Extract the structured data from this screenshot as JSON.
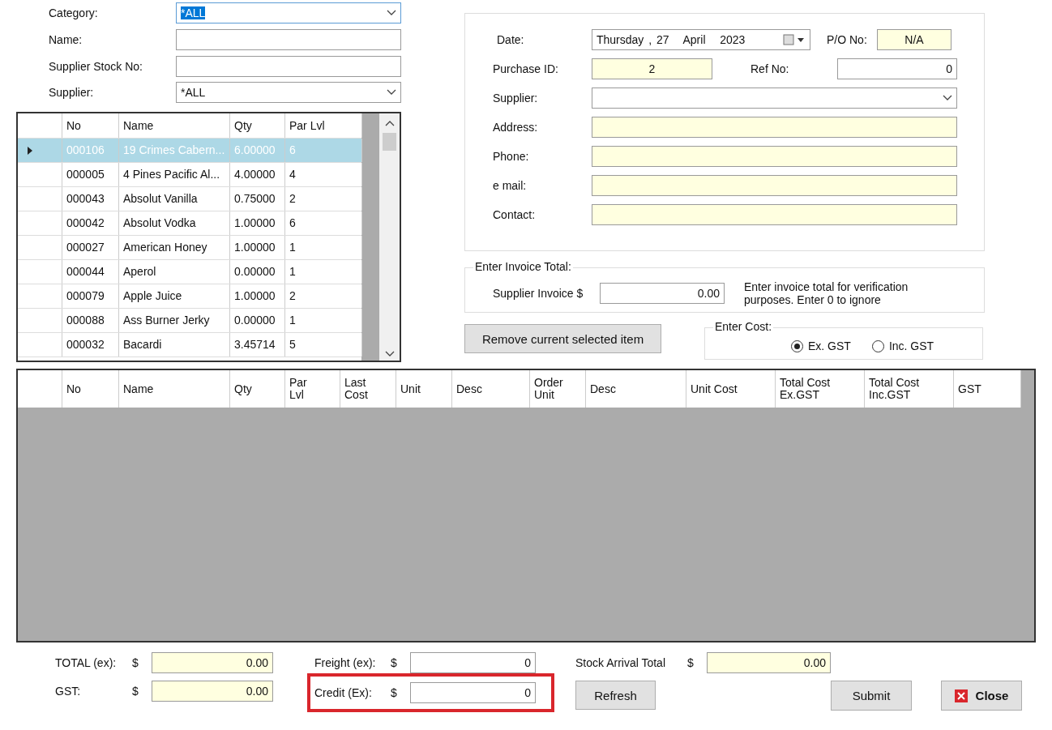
{
  "filters": [
    {
      "kind": "dropdown",
      "label": "Category:",
      "value": "*ALL",
      "highlighted": true
    },
    {
      "kind": "text",
      "label": "Name:"
    },
    {
      "kind": "text",
      "label": "Supplier Stock No:"
    },
    {
      "kind": "dropdown",
      "label": "Supplier:",
      "value": "*ALL",
      "highlighted": false
    }
  ],
  "item_grid": {
    "columns": [
      "No",
      "Name",
      "Qty",
      "Par Lvl"
    ],
    "rows": [
      {
        "selected": true,
        "cells": [
          "000106",
          "19 Crimes Cabern...",
          "6.00000",
          "6"
        ]
      },
      {
        "selected": false,
        "cells": [
          "000005",
          "4 Pines Pacific Al...",
          "4.00000",
          "4"
        ]
      },
      {
        "selected": false,
        "cells": [
          "000043",
          "Absolut Vanilla",
          "0.75000",
          "2"
        ]
      },
      {
        "selected": false,
        "cells": [
          "000042",
          "Absolut Vodka",
          "1.00000",
          "6"
        ]
      },
      {
        "selected": false,
        "cells": [
          "000027",
          "American Honey",
          "1.00000",
          "1"
        ]
      },
      {
        "selected": false,
        "cells": [
          "000044",
          "Aperol",
          "0.00000",
          "1"
        ]
      },
      {
        "selected": false,
        "cells": [
          "000079",
          "Apple Juice",
          "1.00000",
          "2"
        ]
      },
      {
        "selected": false,
        "cells": [
          "000088",
          "Ass Burner Jerky",
          "0.00000",
          "1"
        ]
      },
      {
        "selected": false,
        "cells": [
          "000032",
          "Bacardi",
          "3.45714",
          "5"
        ]
      }
    ]
  },
  "purchase": {
    "date": {
      "label": "Date:",
      "value": "Thursday , 27   April   2023"
    },
    "po_no": {
      "label": "P/O No:",
      "value": "N/A"
    },
    "purchase_id": {
      "label": "Purchase ID:",
      "value": "2"
    },
    "ref_no": {
      "label": "Ref No:",
      "value": "0"
    },
    "supplier": {
      "label": "Supplier:"
    },
    "details": [
      {
        "label": "Address:"
      },
      {
        "label": "Phone:"
      },
      {
        "label": "e mail:"
      },
      {
        "label": "Contact:"
      }
    ]
  },
  "invoice_total": {
    "legend": "Enter Invoice Total:",
    "label": "Supplier Invoice $",
    "value": "0.00",
    "note": "Enter invoice total for verification purposes. Enter 0 to ignore"
  },
  "remove_button": "Remove current selected item",
  "enter_cost": {
    "legend": "Enter Cost:",
    "options": [
      {
        "label": "Ex. GST",
        "selected": true
      },
      {
        "label": "Inc. GST",
        "selected": false
      }
    ]
  },
  "order_grid": {
    "columns": [
      "No",
      "Name",
      "Qty",
      "Par\nLvl",
      "Last\nCost",
      "Unit",
      "Desc",
      "Order\nUnit",
      "Desc",
      "Unit Cost",
      "Total Cost\nEx.GST",
      "Total Cost\nInc.GST",
      "GST"
    ]
  },
  "totals": {
    "total_ex": {
      "label": "TOTAL (ex):",
      "currency": "$",
      "value": "0.00"
    },
    "gst": {
      "label": "GST:",
      "currency": "$",
      "value": "0.00"
    },
    "freight": {
      "label": "Freight (ex):",
      "currency": "$",
      "value": "0"
    },
    "credit": {
      "label": "Credit (Ex):",
      "currency": "$",
      "value": "0",
      "highlighted": true
    },
    "stock_arrival": {
      "label": "Stock Arrival Total",
      "currency": "$",
      "value": "0.00"
    }
  },
  "buttons": {
    "refresh": "Refresh",
    "submit": "Submit",
    "close": "Close"
  }
}
